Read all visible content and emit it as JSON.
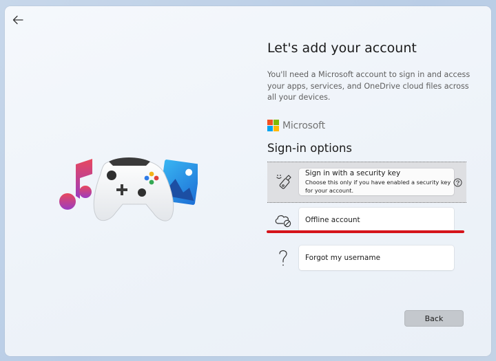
{
  "header": {
    "title": "Let's add your account",
    "description": "You'll need a Microsoft account to sign in and access your apps, services, and OneDrive cloud files across all your devices."
  },
  "brand": {
    "name": "Microsoft",
    "colors": [
      "#f25022",
      "#7fba00",
      "#00a4ef",
      "#ffb900"
    ]
  },
  "signin": {
    "heading": "Sign-in options",
    "options": [
      {
        "label": "Sign in with a security key",
        "hint": "Choose this only if you have enabled a security key for your account.",
        "icon": "security-key-icon",
        "selected": true
      },
      {
        "label": "Offline account",
        "icon": "cloud-offline-icon"
      },
      {
        "label": "Forgot my username",
        "icon": "question-mark-icon"
      }
    ]
  },
  "footer": {
    "back_label": "Back"
  },
  "colors": {
    "highlight_line": "#d5141b",
    "selected_row_bg": "#dedfe2"
  }
}
